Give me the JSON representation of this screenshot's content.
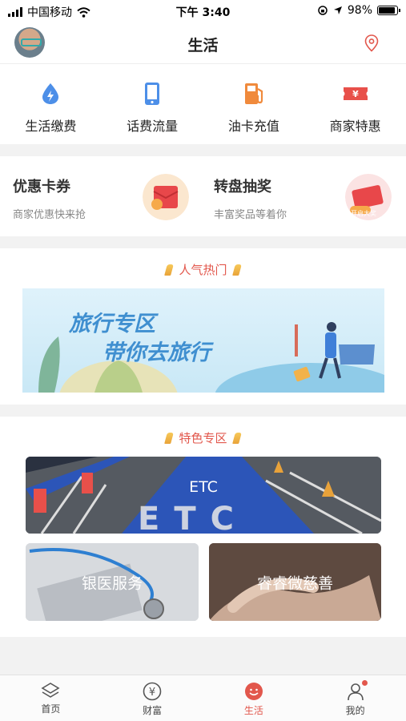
{
  "status_bar": {
    "carrier": "中国移动",
    "time": "下午 3:40",
    "battery": "98%"
  },
  "header": {
    "title": "生活"
  },
  "quick_actions": [
    {
      "label": "生活缴费",
      "icon": "water-drop-icon"
    },
    {
      "label": "话费流量",
      "icon": "phone-icon"
    },
    {
      "label": "油卡充值",
      "icon": "fuel-pump-icon"
    },
    {
      "label": "商家特惠",
      "icon": "coupon-icon"
    }
  ],
  "promos": [
    {
      "title": "优惠卡券",
      "subtitle": "商家优惠快来抢",
      "icon": "coupon-envelope-icon"
    },
    {
      "title": "转盘抽奖",
      "subtitle": "丰富奖品等着你",
      "icon": "lottery-envelope-icon",
      "badge": "开启大奖"
    }
  ],
  "popular": {
    "title": "人气热门",
    "banner_line1": "旅行专区",
    "banner_line2": "带你去旅行"
  },
  "featured": {
    "title": "特色专区",
    "cards": [
      {
        "label": "ETC",
        "road_text": "ETC"
      },
      {
        "label": "银医服务"
      },
      {
        "label": "睿睿微慈善"
      }
    ]
  },
  "tabs": [
    {
      "label": "首页",
      "icon": "home-icon",
      "active": false
    },
    {
      "label": "财富",
      "icon": "yen-icon",
      "active": false
    },
    {
      "label": "生活",
      "icon": "smile-icon",
      "active": true
    },
    {
      "label": "我的",
      "icon": "user-icon",
      "active": false
    }
  ],
  "colors": {
    "accent": "#e2574c",
    "blue_icon": "#4d8fe8",
    "orange_icon": "#f08a3c",
    "red_icon": "#e8504a"
  }
}
